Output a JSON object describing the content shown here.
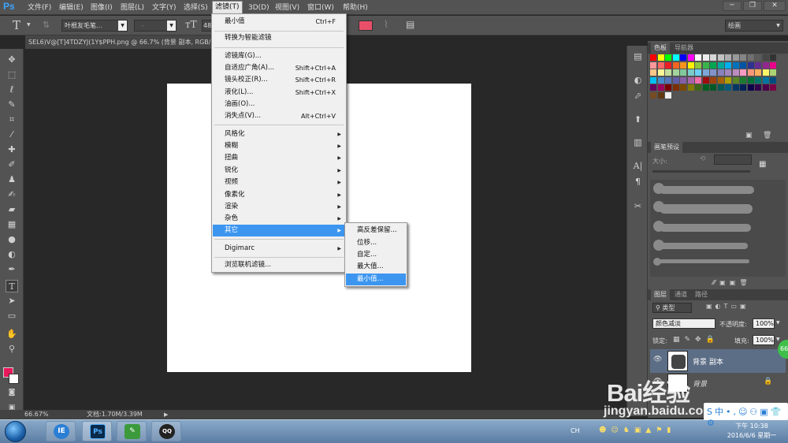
{
  "app": {
    "logo": "Ps"
  },
  "menubar": {
    "items": [
      "文件(F)",
      "编辑(E)",
      "图像(I)",
      "图层(L)",
      "文字(Y)",
      "选择(S)",
      "滤镜(T)",
      "3D(D)",
      "视图(V)",
      "窗口(W)",
      "帮助(H)"
    ],
    "active_index": 6
  },
  "window_controls": {
    "minimize": "─",
    "restore": "❐",
    "close": "✕"
  },
  "options_bar": {
    "text_tool_glyph": "T",
    "font_family": "叶根友毛笔...",
    "font_style": "-",
    "font_size": "48",
    "workspace": "绘画"
  },
  "document": {
    "tab_title": "SEL6)V@[T]4TDZYJ(1Y$PPH.png @ 66.7% (背景 副本, RGB/",
    "zoom": "66.67%",
    "doc_info": "文档:1.70M/3.39M"
  },
  "filter_menu": {
    "items": [
      {
        "label": "最小值",
        "shortcut": "Ctrl+F"
      },
      {
        "label": "转换为智能滤镜"
      },
      {
        "label": "滤镜库(G)..."
      },
      {
        "label": "自适应广角(A)...",
        "shortcut": "Shift+Ctrl+A"
      },
      {
        "label": "镜头校正(R)...",
        "shortcut": "Shift+Ctrl+R"
      },
      {
        "label": "液化(L)...",
        "shortcut": "Shift+Ctrl+X"
      },
      {
        "label": "油画(O)..."
      },
      {
        "label": "消失点(V)...",
        "shortcut": "Alt+Ctrl+V"
      },
      {
        "label": "风格化"
      },
      {
        "label": "模糊"
      },
      {
        "label": "扭曲"
      },
      {
        "label": "锐化"
      },
      {
        "label": "视频"
      },
      {
        "label": "像素化"
      },
      {
        "label": "渲染"
      },
      {
        "label": "杂色"
      },
      {
        "label": "其它"
      },
      {
        "label": "Digimarc"
      },
      {
        "label": "浏览联机滤镜..."
      }
    ],
    "highlighted": "其它"
  },
  "submenu_other": {
    "items": [
      "高反差保留...",
      "位移...",
      "自定...",
      "最大值...",
      "最小值..."
    ],
    "highlighted": "最小值..."
  },
  "panels": {
    "swatches_tabs": [
      "色板",
      "导航器"
    ],
    "brush_presets_tab": "画笔预设",
    "brush_size_label": "大小:",
    "layers_tabs": [
      "图层",
      "通道",
      "路径"
    ],
    "layer_filter": "类型",
    "blend_mode": "颜色减淡",
    "opacity_label": "不透明度:",
    "opacity_value": "100%",
    "lock_label": "锁定:",
    "fill_label": "填充:",
    "fill_value": "100%",
    "layers": [
      {
        "name": "背景 副本",
        "selected": true
      },
      {
        "name": "背景",
        "selected": false
      }
    ],
    "swatch_colors": [
      "#ff0000",
      "#ffff00",
      "#00ff00",
      "#00ffff",
      "#0000ff",
      "#ff00ff",
      "#ffffff",
      "#ebebeb",
      "#d6d6d6",
      "#c2c2c2",
      "#adadad",
      "#999999",
      "#858585",
      "#707070",
      "#5c5c5c",
      "#474747",
      "#333333",
      "#1f1f1f",
      "#0a0a0a",
      "#000000",
      "#ff9999",
      "#ff6666",
      "#ed1c24",
      "#f26522",
      "#f7941d",
      "#fff200",
      "#8dc63f",
      "#39b54a",
      "#00a651",
      "#00a99d",
      "#00aeef",
      "#0072bc",
      "#0054a6",
      "#2e3192",
      "#662d91",
      "#92278f",
      "#ec008c",
      "#ed145b",
      "#f5989d",
      "#f9ad81",
      "#fdc68a",
      "#fff799",
      "#c4df9b",
      "#a3d39c",
      "#82ca9c",
      "#7accc8",
      "#6dcff6",
      "#7da7d9",
      "#8393ca",
      "#8781bd",
      "#a187be",
      "#bd8cbf",
      "#f49ac1",
      "#f7977a",
      "#fbaf5d",
      "#fff568",
      "#acd373",
      "#7cc576",
      "#3cb878",
      "#1cbbb4",
      "#00bff3",
      "#448ccb",
      "#5574b9",
      "#605ca8",
      "#855fa8",
      "#a864a8",
      "#f06eaa",
      "#9e0b0f",
      "#a0410d",
      "#a36209",
      "#aba000",
      "#598527",
      "#1a7b30",
      "#007236",
      "#00746b",
      "#0076a3",
      "#004b80",
      "#003471",
      "#1b1464",
      "#440e62",
      "#630460",
      "#9e005d",
      "#790000",
      "#7b2e00",
      "#7d4900",
      "#827b00",
      "#406618",
      "#005e20",
      "#005826",
      "#005952",
      "#005b7f",
      "#003663",
      "#002157",
      "#0d004c",
      "#32004b",
      "#4b0049",
      "#7b0046",
      "#c69c6d",
      "#a67c52",
      "#8c6239",
      "#754c24",
      "#603913",
      "#f0f0f0"
    ]
  },
  "taskbar": {
    "tasks": [
      "IE",
      "Ps",
      "✎",
      "QQ"
    ],
    "tray_lang": "CH",
    "time": "下午 10:38",
    "date": "2016/6/6 星期一"
  },
  "watermark": {
    "logo": "Bai经验",
    "url": "jingyan.baidu.com"
  },
  "colors": {
    "accent": "#3c96f0",
    "foreground": "#e8185c",
    "option_swatch": "#e8506a"
  }
}
